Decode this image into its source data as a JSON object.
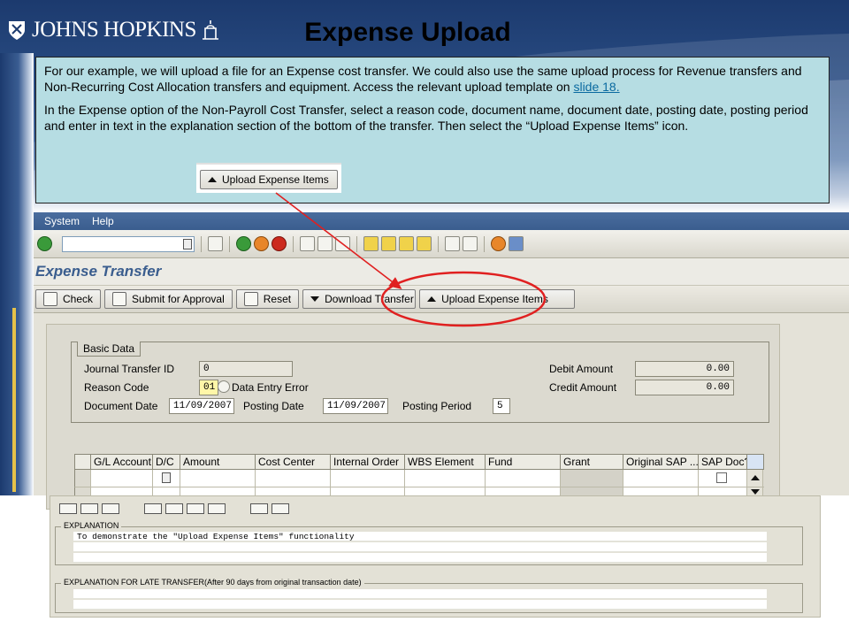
{
  "slide": {
    "logo_text": "JOHNS HOPKINS",
    "title": "Expense Upload",
    "callout": {
      "paragraph1": "For our example, we will upload a file for an Expense cost transfer. We could also use the same upload process for Revenue transfers and Non-Recurring Cost Allocation transfers and equipment. Access the relevant upload template on",
      "link": "slide 18.",
      "paragraph2": "In the Expense option of the Non-Payroll Cost Transfer, select a reason code, document name, document date, posting date, posting period and enter in text in the explanation section of the bottom of the transfer. Then select the “Upload Expense Items” icon.",
      "button_label": "Upload Expense Items"
    },
    "colors": {
      "band": "#1c3a6e",
      "callout_bg": "#b6dde3",
      "highlight_ring": "#e02020",
      "link": "#0a6aa0"
    }
  },
  "sap": {
    "menu": [
      "System",
      "Help"
    ],
    "screen_title": "Expense Transfer",
    "app_toolbar": {
      "check": "Check",
      "submit": "Submit for Approval",
      "reset": "Reset",
      "download": "Download Transfer",
      "upload": "Upload Expense Items"
    },
    "basic_data": {
      "section_label": "Basic Data",
      "journal_transfer_id_label": "Journal Transfer ID",
      "journal_transfer_id": "0",
      "reason_code_label": "Reason Code",
      "reason_code": "01",
      "reason_code_text": "Data Entry Error",
      "document_date_label": "Document Date",
      "document_date": "11/09/2007",
      "posting_date_label": "Posting Date",
      "posting_date": "11/09/2007",
      "posting_period_label": "Posting Period",
      "posting_period": "5",
      "debit_amount_label": "Debit Amount",
      "debit_amount": "0.00",
      "credit_amount_label": "Credit Amount",
      "credit_amount": "0.00"
    },
    "table": {
      "columns": [
        "G/L Account",
        "D/C",
        "Amount",
        "Cost Center",
        "Internal Order",
        "WBS Element",
        "Fund",
        "Grant",
        "Original SAP ...",
        "SAP Doc?"
      ]
    },
    "explanation": {
      "label": "EXPLANATION",
      "text": "To demonstrate the \"Upload Expense Items\" functionality",
      "late_label": "EXPLANATION FOR LATE TRANSFER(After 90 days from original transaction date)"
    }
  }
}
